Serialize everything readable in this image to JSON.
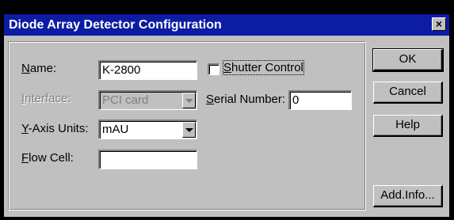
{
  "window": {
    "title": "Diode Array Detector Configuration",
    "close_symbol": "×"
  },
  "form": {
    "name_label_u": "N",
    "name_label_rest": "ame:",
    "name_value": "K-2800",
    "interface_label_u": "I",
    "interface_label_rest": "nterface:",
    "interface_value": "PCI card",
    "yaxis_label_u": "Y",
    "yaxis_label_rest": "-Axis Units:",
    "yaxis_value": "mAU",
    "flowcell_label_u": "F",
    "flowcell_label_rest": "low Cell:",
    "flowcell_value": "",
    "shutter_label_u": "S",
    "shutter_label_rest": "hutter Control",
    "shutter_checked": false,
    "serial_label_u": "S",
    "serial_label_rest": "erial Number:",
    "serial_value": "0"
  },
  "buttons": {
    "ok": "OK",
    "cancel": "Cancel",
    "help": "Help",
    "add_info": "Add.Info..."
  },
  "colors": {
    "titlebar": "#0c1ca3",
    "face": "#c0c0c0"
  }
}
